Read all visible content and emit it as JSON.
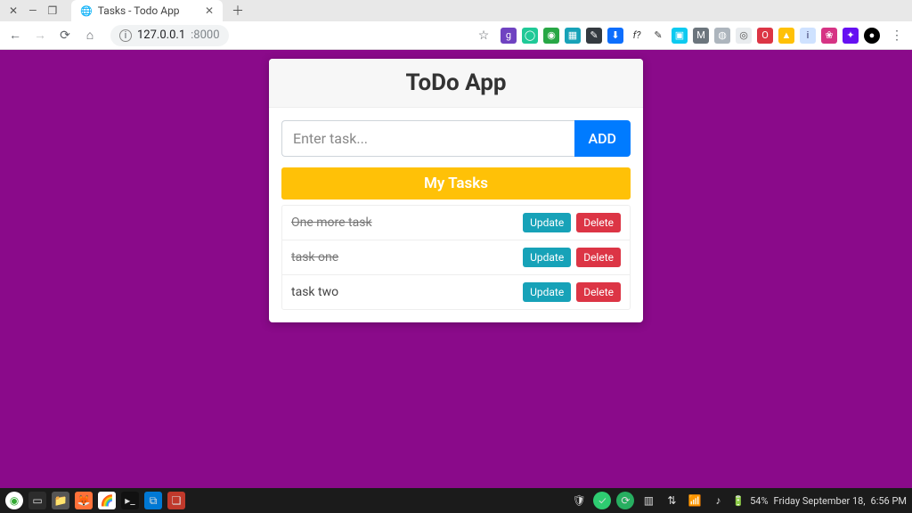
{
  "browser": {
    "tab_title": "Tasks - Todo App",
    "url_host": "127.0.0.1",
    "url_port": ":8000"
  },
  "app": {
    "title": "ToDo App",
    "input_placeholder": "Enter task...",
    "add_label": "ADD",
    "section_label": "My Tasks",
    "update_label": "Update",
    "delete_label": "Delete",
    "tasks": [
      {
        "text": "One more task",
        "done": true
      },
      {
        "text": "task one",
        "done": true
      },
      {
        "text": "task two",
        "done": false
      }
    ]
  },
  "os": {
    "battery": "54%",
    "date": "Friday September 18,",
    "time": "6:56 PM"
  }
}
